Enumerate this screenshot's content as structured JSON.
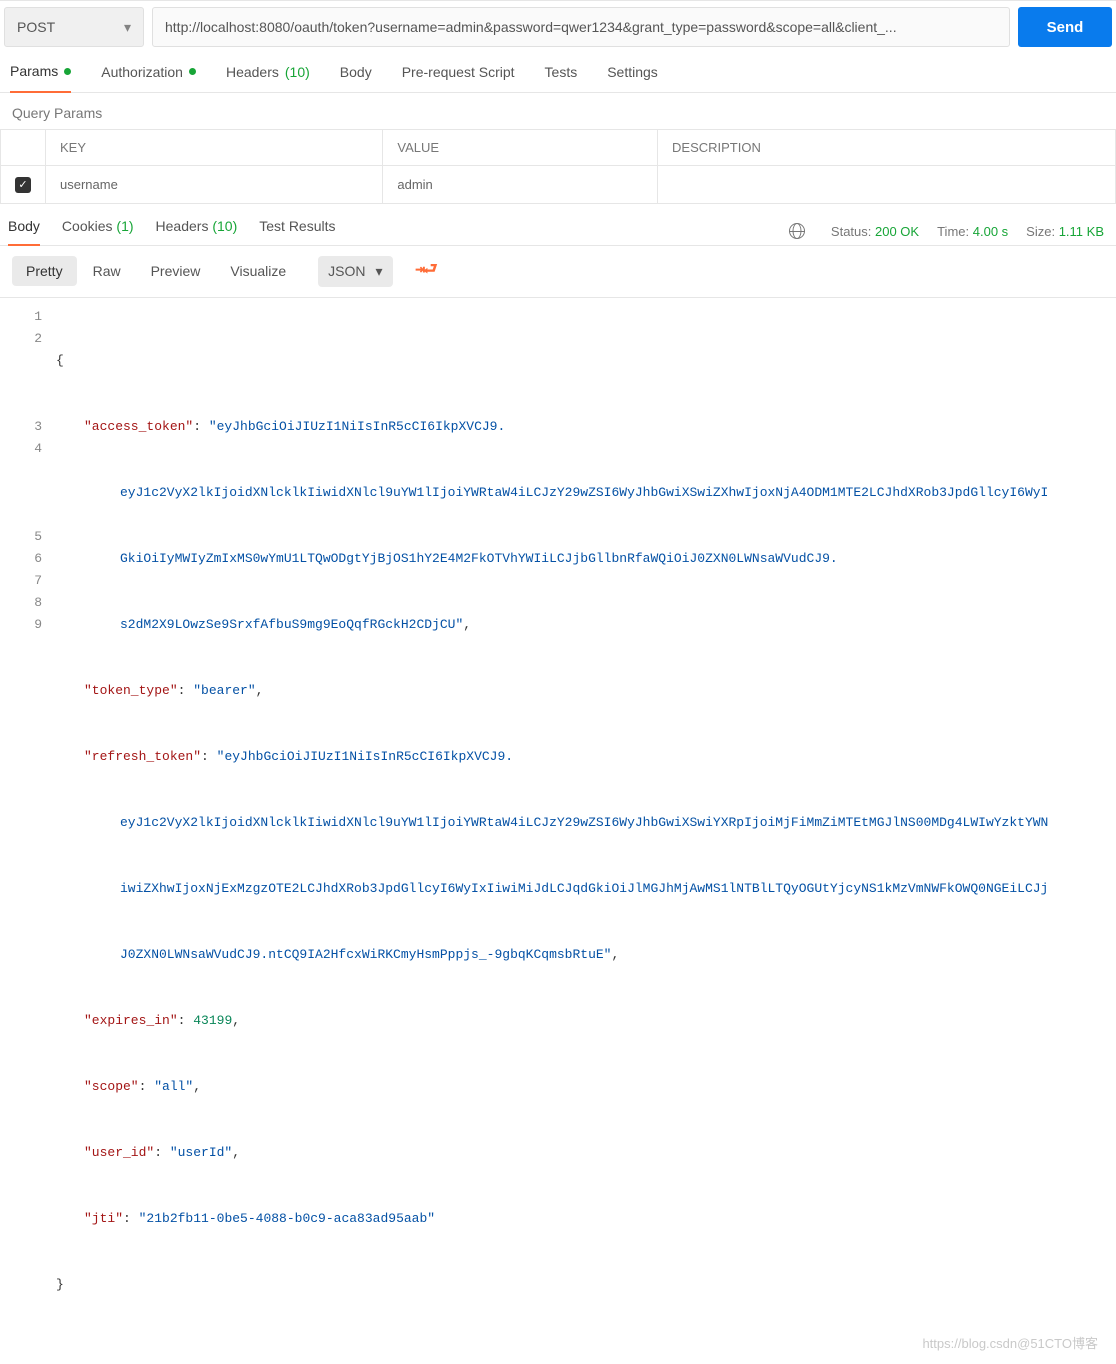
{
  "request": {
    "method": "POST",
    "url": "http://localhost:8080/oauth/token?username=admin&password=qwer1234&grant_type=password&scope=all&client_...",
    "send_label": "Send"
  },
  "req_tabs": {
    "params": "Params",
    "auth": "Authorization",
    "headers": "Headers",
    "headers_count": "(10)",
    "body": "Body",
    "prs": "Pre-request Script",
    "tests": "Tests",
    "settings": "Settings"
  },
  "query_params": {
    "title": "Query Params",
    "cols": {
      "key": "KEY",
      "value": "VALUE",
      "desc": "DESCRIPTION"
    },
    "row": {
      "key": "username",
      "value": "admin"
    }
  },
  "resp_tabs": {
    "body": "Body",
    "cookies": "Cookies",
    "cookies_count": "(1)",
    "headers": "Headers",
    "headers_count": "(10)",
    "tests": "Test Results"
  },
  "resp_meta": {
    "status_label": "Status:",
    "status_value": "200 OK",
    "time_label": "Time:",
    "time_value": "4.00 s",
    "size_label": "Size:",
    "size_value": "1.11 KB"
  },
  "body_tb": {
    "pretty": "Pretty",
    "raw": "Raw",
    "preview": "Preview",
    "visualize": "Visualize",
    "format": "JSON"
  },
  "json_text": {
    "l1": "{",
    "l2a": "\"access_token\"",
    "l2b": "\"eyJhbGciOiJIUzI1NiIsInR5cCI6IkpXVCJ9.",
    "l2c": "eyJ1c2VyX2lkIjoidXNlcklkIiwidXNlcl9uYW1lIjoiYWRtaW4iLCJzY29wZSI6WyJhbGwiXSwiZXhwIjoxNjA4ODM1MTE2LCJhdXRob3JpdGllcyI6WyI",
    "l2d": "GkiOiIyMWIyZmIxMS0wYmU1LTQwODgtYjBjOS1hY2E4M2FkOTVhYWIiLCJjbGllbnRfaWQiOiJ0ZXN0LWNsaWVudCJ9.",
    "l2e": "s2dM2X9LOwzSe9SrxfAfbuS9mg9EoQqfRGckH2CDjCU\"",
    "l3a": "\"token_type\"",
    "l3b": "\"bearer\"",
    "l4a": "\"refresh_token\"",
    "l4b": "\"eyJhbGciOiJIUzI1NiIsInR5cCI6IkpXVCJ9.",
    "l4c": "eyJ1c2VyX2lkIjoidXNlcklkIiwidXNlcl9uYW1lIjoiYWRtaW4iLCJzY29wZSI6WyJhbGwiXSwiYXRpIjoiMjFiMmZiMTEtMGJlNS00MDg4LWIwYzktYWN",
    "l4d": "iwiZXhwIjoxNjExMzgzOTE2LCJhdXRob3JpdGllcyI6WyIxIiwiMiJdLCJqdGkiOiJlMGJhMjAwMS1lNTBlLTQyOGUtYjcyNS1kMzVmNWFkOWQ0NGEiLCJj",
    "l4e": "J0ZXN0LWNsaWVudCJ9.ntCQ9IA2HfcxWiRKCmyHsmPppjs_-9gbqKCqmsbRtuE\"",
    "l5a": "\"expires_in\"",
    "l5b": "43199",
    "l6a": "\"scope\"",
    "l6b": "\"all\"",
    "l7a": "\"user_id\"",
    "l7b": "\"userId\"",
    "l8a": "\"jti\"",
    "l8b": "\"21b2fb11-0be5-4088-b0c9-aca83ad95aab\"",
    "l9": "}"
  },
  "line_numbers": [
    "1",
    "2",
    "",
    "",
    "",
    "3",
    "4",
    "",
    "",
    "",
    "5",
    "6",
    "7",
    "8",
    "9"
  ],
  "watermark": "https://blog.csdn@51CTO博客"
}
